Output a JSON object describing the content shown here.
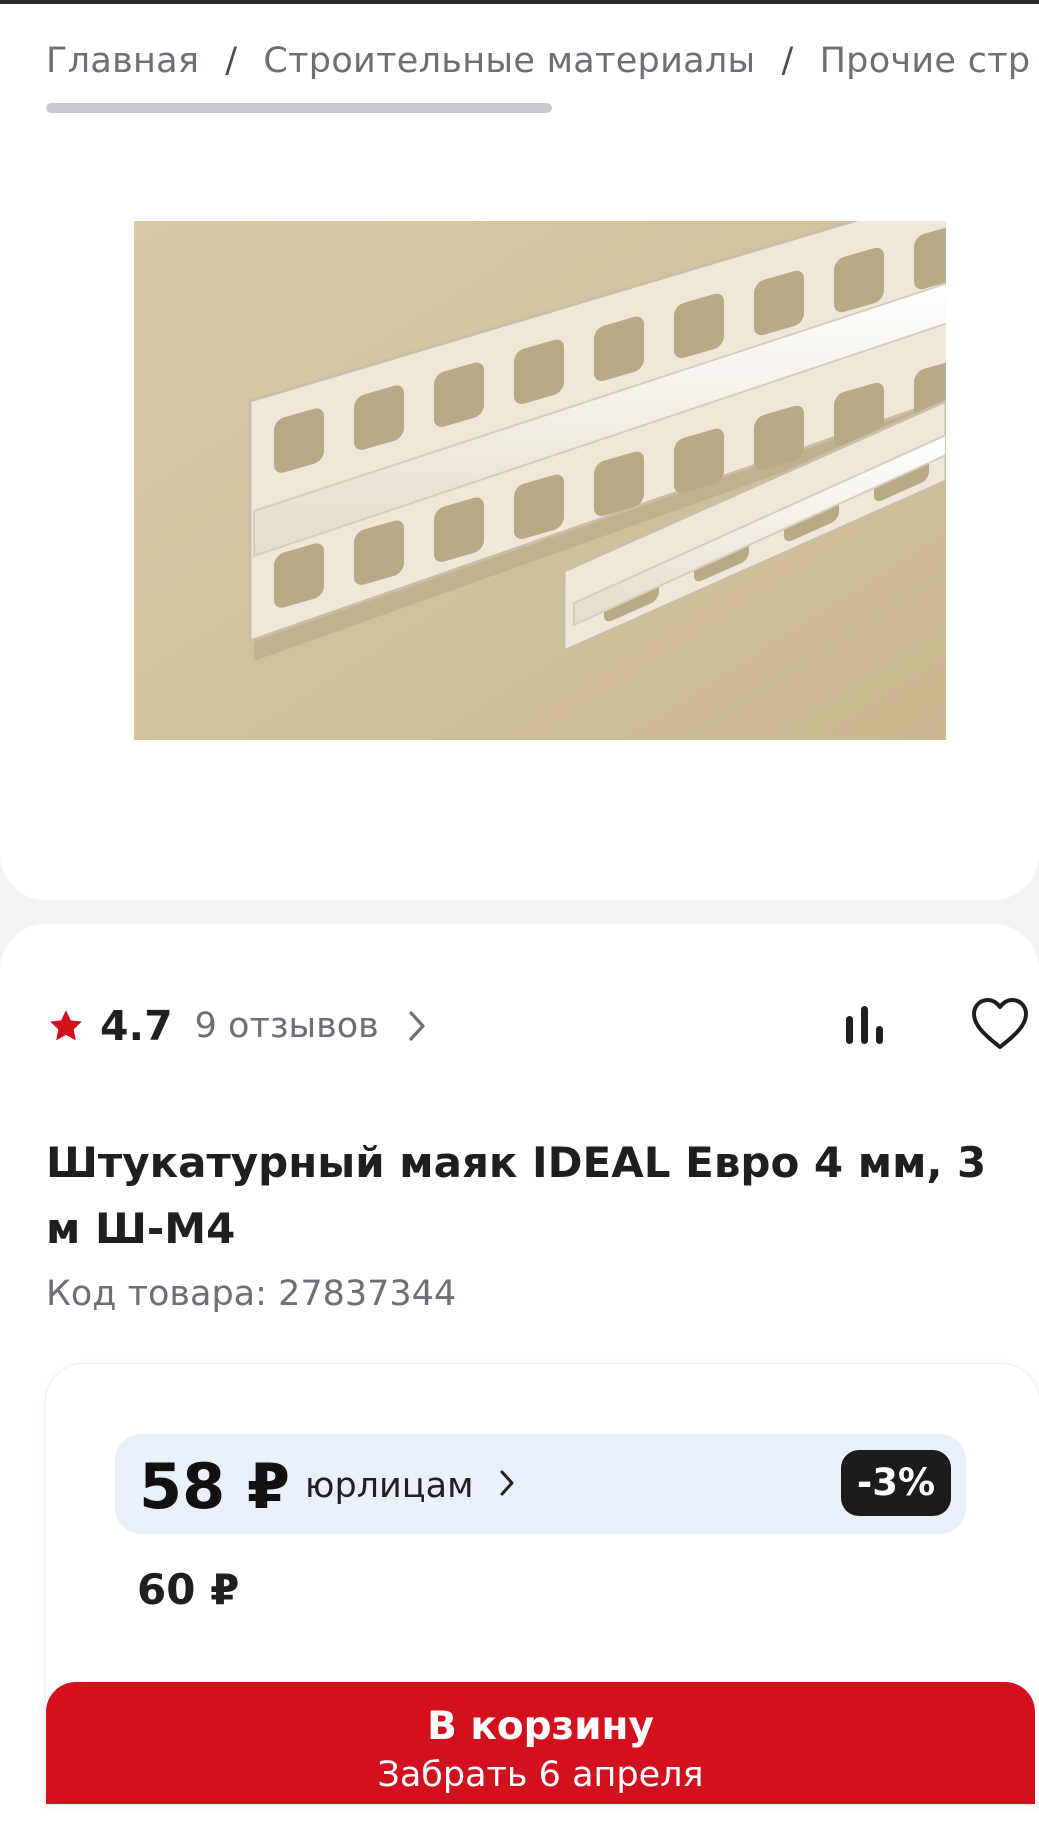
{
  "breadcrumb": {
    "items": [
      {
        "label": "Главная"
      },
      {
        "label": "Строительные материалы"
      },
      {
        "label": "Прочие стр"
      }
    ],
    "separator": "/"
  },
  "product_image": {
    "icon": "product-photo-plaster-beacon"
  },
  "rating": {
    "value": "4.7",
    "reviews": "9 отзывов",
    "star_color": "#d3111e"
  },
  "actions": {
    "compare_icon": "compare-icon",
    "favorite_icon": "heart-icon"
  },
  "product": {
    "title": "Штукатурный маяк IDEAL Евро 4 мм, 3 м Ш-М4",
    "sku_label": "Код товара:",
    "sku_value": "27837344"
  },
  "price": {
    "b2b_price": "58 ₽",
    "b2b_label": "юрлицам",
    "discount": "-3%",
    "regular": "60 ₽"
  },
  "cart": {
    "label": "В корзину",
    "pickup": "Забрать 6 апреля",
    "color": "#d3111e"
  }
}
